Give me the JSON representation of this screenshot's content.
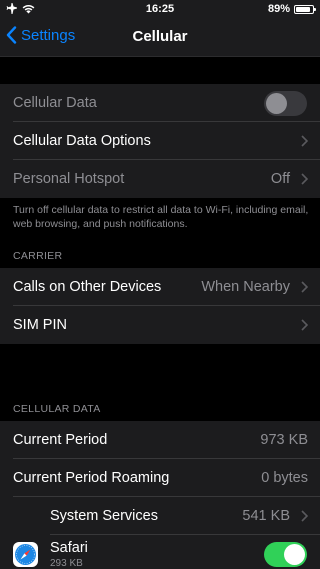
{
  "status": {
    "time": "16:25",
    "battery_percent": "89%",
    "battery_level": 0.89
  },
  "nav": {
    "back_label": "Settings",
    "title": "Cellular"
  },
  "main_group": {
    "cellular_data": {
      "label": "Cellular Data",
      "enabled": false
    },
    "cellular_data_options": {
      "label": "Cellular Data Options"
    },
    "personal_hotspot": {
      "label": "Personal Hotspot",
      "value": "Off"
    }
  },
  "footer_note": "Turn off cellular data to restrict all data to Wi-Fi, including email, web browsing, and push notifications.",
  "carrier": {
    "header": "CARRIER",
    "calls_on_other_devices": {
      "label": "Calls on Other Devices",
      "value": "When Nearby"
    },
    "sim_pin": {
      "label": "SIM PIN"
    }
  },
  "cellular_data_section": {
    "header": "CELLULAR DATA",
    "current_period": {
      "label": "Current Period",
      "value": "973 KB"
    },
    "current_period_roaming": {
      "label": "Current Period Roaming",
      "value": "0 bytes"
    },
    "system_services": {
      "label": "System Services",
      "value": "541 KB"
    },
    "safari": {
      "label": "Safari",
      "usage": "293 KB",
      "enabled": true
    }
  },
  "colors": {
    "accent": "#0a84ff",
    "toggle_on": "#30d158",
    "secondary_text": "#8e8e93",
    "cell_bg": "#1c1c1e"
  }
}
